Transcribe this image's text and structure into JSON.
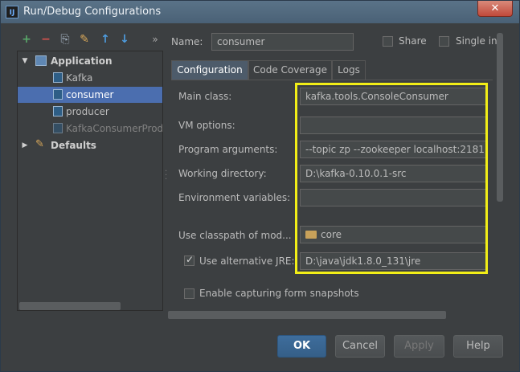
{
  "window": {
    "title": "Run/Debug Configurations",
    "app_icon": "IJ",
    "close_glyph": "✕"
  },
  "toolbar": {
    "add": "+",
    "remove": "−",
    "copy": "⎘",
    "edit": "✎",
    "up": "↑",
    "down": "↓",
    "more": "»"
  },
  "tree": {
    "items": [
      {
        "label": "Application"
      },
      {
        "label": "Kafka"
      },
      {
        "label": "consumer"
      },
      {
        "label": "producer"
      },
      {
        "label": "KafkaConsumerProd"
      },
      {
        "label": "Defaults"
      }
    ]
  },
  "header": {
    "name_label": "Name:",
    "name_value": "consumer",
    "share_label": "Share",
    "single_label": "Single in"
  },
  "tabs": [
    {
      "label": "Configuration"
    },
    {
      "label": "Code Coverage"
    },
    {
      "label": "Logs"
    }
  ],
  "form": {
    "main_class_label": "Main class:",
    "main_class_value": "kafka.tools.ConsoleConsumer",
    "vm_options_label": "VM options:",
    "vm_options_value": "",
    "program_args_label": "Program arguments:",
    "program_args_value": "--topic zp --zookeeper localhost:2181",
    "working_dir_label": "Working directory:",
    "working_dir_value": "D:\\kafka-0.10.0.1-src",
    "env_vars_label": "Environment variables:",
    "env_vars_value": "",
    "classpath_label": "Use classpath of mod...",
    "classpath_value": "core",
    "alt_jre_label": "Use alternative JRE:",
    "alt_jre_value": "D:\\java\\jdk1.8.0_131\\jre",
    "snapshots_label": "Enable capturing form snapshots"
  },
  "buttons": {
    "ok": "OK",
    "cancel": "Cancel",
    "apply": "Apply",
    "help": "Help"
  },
  "colors": {
    "highlight": "#f2ee17",
    "selection": "#4b6eaf",
    "background": "#3c3f41"
  }
}
